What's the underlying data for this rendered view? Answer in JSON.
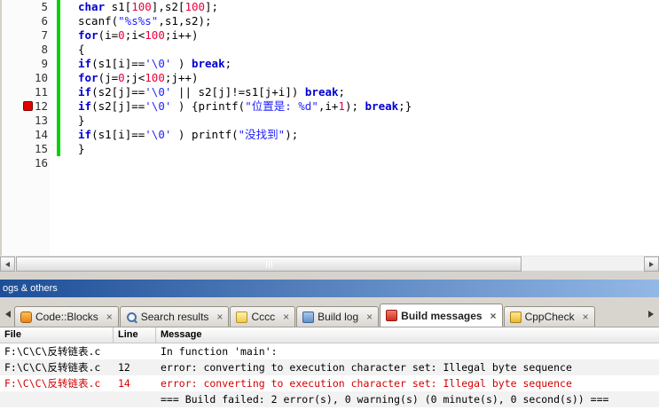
{
  "colors": {
    "keyword": "#0000d0",
    "string": "#2121ff",
    "number": "#e8003c",
    "error_text": "#d40000",
    "change_bar": "#00d300",
    "breakpoint": "#e00000"
  },
  "editor": {
    "breakpoint_line": 12,
    "lines": [
      {
        "num": 5,
        "tokens": [
          [
            "kw",
            "char"
          ],
          [
            "pl",
            " s1["
          ],
          [
            "num",
            "100"
          ],
          [
            "pl",
            "],s2["
          ],
          [
            "num",
            "100"
          ],
          [
            "pl",
            "];"
          ]
        ]
      },
      {
        "num": 6,
        "tokens": [
          [
            "pl",
            "scanf("
          ],
          [
            "str",
            "\"%s%s\""
          ],
          [
            "pl",
            ",s1,s2);"
          ]
        ]
      },
      {
        "num": 7,
        "tokens": [
          [
            "kw",
            "for"
          ],
          [
            "pl",
            "(i="
          ],
          [
            "num",
            "0"
          ],
          [
            "pl",
            ";i<"
          ],
          [
            "num",
            "100"
          ],
          [
            "pl",
            ";i++)"
          ]
        ]
      },
      {
        "num": 8,
        "tokens": [
          [
            "pl",
            "{"
          ]
        ]
      },
      {
        "num": 9,
        "tokens": [
          [
            "kw",
            "if"
          ],
          [
            "pl",
            "(s1[i]=="
          ],
          [
            "str",
            "'\\0'"
          ],
          [
            "pl",
            " ) "
          ],
          [
            "kw",
            "break"
          ],
          [
            "pl",
            ";"
          ]
        ]
      },
      {
        "num": 10,
        "tokens": [
          [
            "kw",
            "for"
          ],
          [
            "pl",
            "(j="
          ],
          [
            "num",
            "0"
          ],
          [
            "pl",
            ";j<"
          ],
          [
            "num",
            "100"
          ],
          [
            "pl",
            ";j++)"
          ]
        ]
      },
      {
        "num": 11,
        "tokens": [
          [
            "kw",
            "if"
          ],
          [
            "pl",
            "(s2[j]=="
          ],
          [
            "str",
            "'\\0'"
          ],
          [
            "pl",
            " || s2[j]!=s1[j+i]) "
          ],
          [
            "kw",
            "break"
          ],
          [
            "pl",
            ";"
          ]
        ]
      },
      {
        "num": 12,
        "tokens": [
          [
            "kw",
            "if"
          ],
          [
            "pl",
            "(s2[j]=="
          ],
          [
            "str",
            "'\\0'"
          ],
          [
            "pl",
            " ) {printf("
          ],
          [
            "str",
            "\"位置是: %d\""
          ],
          [
            "pl",
            ",i+"
          ],
          [
            "num",
            "1"
          ],
          [
            "pl",
            "); "
          ],
          [
            "kw",
            "break"
          ],
          [
            "pl",
            ";}"
          ]
        ]
      },
      {
        "num": 13,
        "tokens": [
          [
            "pl",
            "}"
          ]
        ]
      },
      {
        "num": 14,
        "tokens": [
          [
            "kw",
            "if"
          ],
          [
            "pl",
            "(s1[i]=="
          ],
          [
            "str",
            "'\\0'"
          ],
          [
            "pl",
            " ) printf("
          ],
          [
            "str",
            "\"没找到\""
          ],
          [
            "pl",
            ");"
          ]
        ]
      },
      {
        "num": 15,
        "tokens": [
          [
            "pl",
            "}"
          ]
        ]
      },
      {
        "num": 16,
        "tokens": []
      }
    ]
  },
  "panel": {
    "caption": "ogs & others"
  },
  "tabs": {
    "close_glyph": "×",
    "items": [
      {
        "label": "Code::Blocks",
        "icon": "codeblocks-icon",
        "active": false
      },
      {
        "label": "Search results",
        "icon": "search-icon",
        "active": false
      },
      {
        "label": "Cccc",
        "icon": "cccc-icon",
        "active": false
      },
      {
        "label": "Build log",
        "icon": "build-log-icon",
        "active": false
      },
      {
        "label": "Build messages",
        "icon": "build-messages-icon",
        "active": true
      },
      {
        "label": "CppCheck",
        "icon": "cppcheck-icon",
        "active": false
      }
    ]
  },
  "messages": {
    "columns": [
      "File",
      "Line",
      "Message"
    ],
    "rows": [
      {
        "file": "F:\\C\\C\\反转链表.c",
        "line": "",
        "message": "In function 'main':",
        "error": false
      },
      {
        "file": "F:\\C\\C\\反转链表.c",
        "line": "12",
        "message": "error: converting to execution character set: Illegal byte sequence",
        "error": false
      },
      {
        "file": "F:\\C\\C\\反转链表.c",
        "line": "14",
        "message": "error: converting to execution character set: Illegal byte sequence",
        "error": true
      },
      {
        "file": "",
        "line": "",
        "message": "=== Build failed: 2 error(s), 0 warning(s) (0 minute(s), 0 second(s)) ===",
        "error": false
      }
    ]
  }
}
